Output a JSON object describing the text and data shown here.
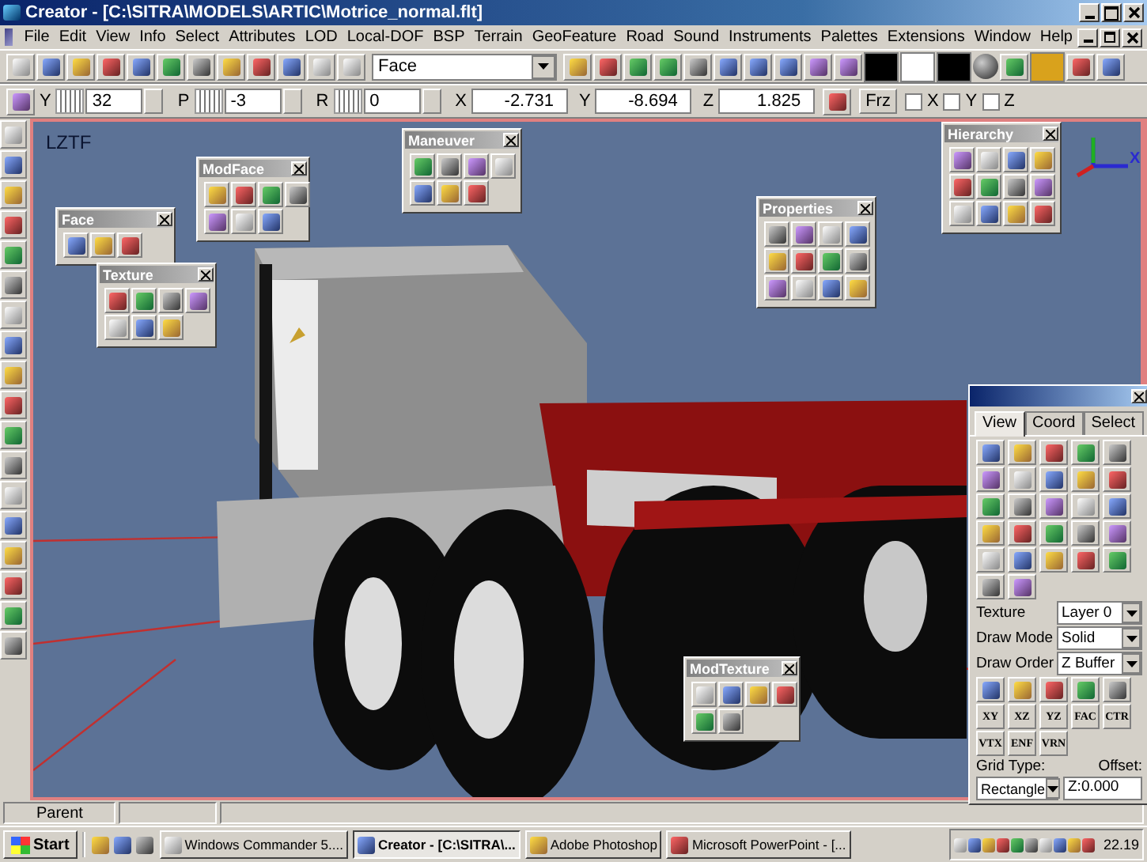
{
  "window": {
    "title": "Creator - [C:\\SITRA\\MODELS\\ARTIC\\Motrice_normal.flt]"
  },
  "menu": [
    "File",
    "Edit",
    "View",
    "Info",
    "Select",
    "Attributes",
    "LOD",
    "Local-DOF",
    "BSP",
    "Terrain",
    "GeoFeature",
    "Road",
    "Sound",
    "Instruments",
    "Palettes",
    "Extensions",
    "Window",
    "Help"
  ],
  "toolbar": {
    "mode": "Face"
  },
  "coord_bar": {
    "fields": [
      {
        "label": "Y",
        "value": "32",
        "kind": "spin"
      },
      {
        "label": "P",
        "value": "-3",
        "kind": "spin"
      },
      {
        "label": "R",
        "value": "0",
        "kind": "spin"
      },
      {
        "label": "X",
        "value": "-2.731",
        "kind": "plain"
      },
      {
        "label": "Y",
        "value": "-8.694",
        "kind": "plain"
      },
      {
        "label": "Z",
        "value": "1.825",
        "kind": "plain"
      }
    ],
    "freeze": "Frz",
    "locks": [
      {
        "label": "X",
        "checked": false
      },
      {
        "label": "Y",
        "checked": false
      },
      {
        "label": "Z",
        "checked": false
      }
    ]
  },
  "viewport": {
    "view_label": "LZTF",
    "axis_label": "X"
  },
  "palettes": [
    {
      "title": "Face"
    },
    {
      "title": "ModFace"
    },
    {
      "title": "Texture"
    },
    {
      "title": "Maneuver"
    },
    {
      "title": "Properties"
    },
    {
      "title": "Hierarchy"
    },
    {
      "title": "ModTexture"
    }
  ],
  "view_panel": {
    "tabs": [
      {
        "label": "View",
        "selected": true
      },
      {
        "label": "Coord",
        "selected": false
      },
      {
        "label": "Select",
        "selected": false
      }
    ],
    "fields": [
      {
        "label": "Texture",
        "value": "Layer 0"
      },
      {
        "label": "Draw Mode",
        "value": "Solid"
      },
      {
        "label": "Draw Order",
        "value": "Z Buffer"
      }
    ],
    "plane_buttons": [
      "XY",
      "XZ",
      "YZ",
      "FAC",
      "CTR"
    ],
    "vertex_buttons": [
      "VTX",
      "ENF",
      "VRN"
    ],
    "grid_type_label": "Grid Type:",
    "grid_type": "Rectangle",
    "offset_label": "Offset:",
    "offset": "Z:0.000"
  },
  "status_bar": {
    "text": "Parent"
  },
  "taskbar": {
    "start": "Start",
    "tasks": [
      {
        "label": "Windows Commander 5....",
        "selected": false
      },
      {
        "label": "Creator - [C:\\SITRA\\...",
        "selected": true
      },
      {
        "label": "Adobe Photoshop",
        "selected": false
      },
      {
        "label": "Microsoft PowerPoint - [...",
        "selected": false
      }
    ],
    "clock": "22.19"
  }
}
